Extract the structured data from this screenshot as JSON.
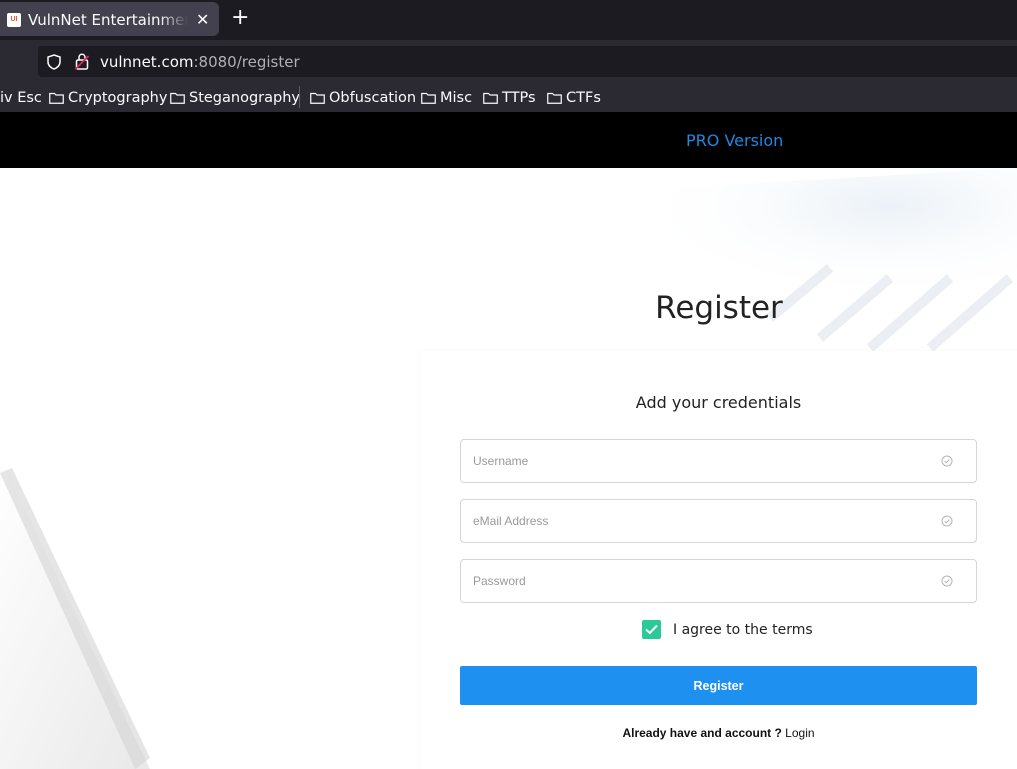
{
  "browser": {
    "tab_title": "VulnNet Entertainment - Register",
    "url_host": "vulnnet.com",
    "url_rest": ":8080/register",
    "bookmarks": [
      "iv Esc",
      "Cryptography",
      "Steganography",
      "Obfuscation",
      "Misc",
      "TTPs",
      "CTFs"
    ]
  },
  "header": {
    "pro_link": "PRO Version",
    "pro_color": "#1e88e5"
  },
  "register": {
    "title": "Register",
    "subtitle": "Add your credentials",
    "username_placeholder": "Username",
    "email_placeholder": "eMail Address",
    "password_placeholder": "Password",
    "terms_label": "I agree to the terms",
    "terms_checked": true,
    "button_label": "Register",
    "account_prompt": "Already have and account ?",
    "login_link": "Login",
    "button_color": "#1e90f0",
    "checkbox_color": "#2bc99a"
  }
}
